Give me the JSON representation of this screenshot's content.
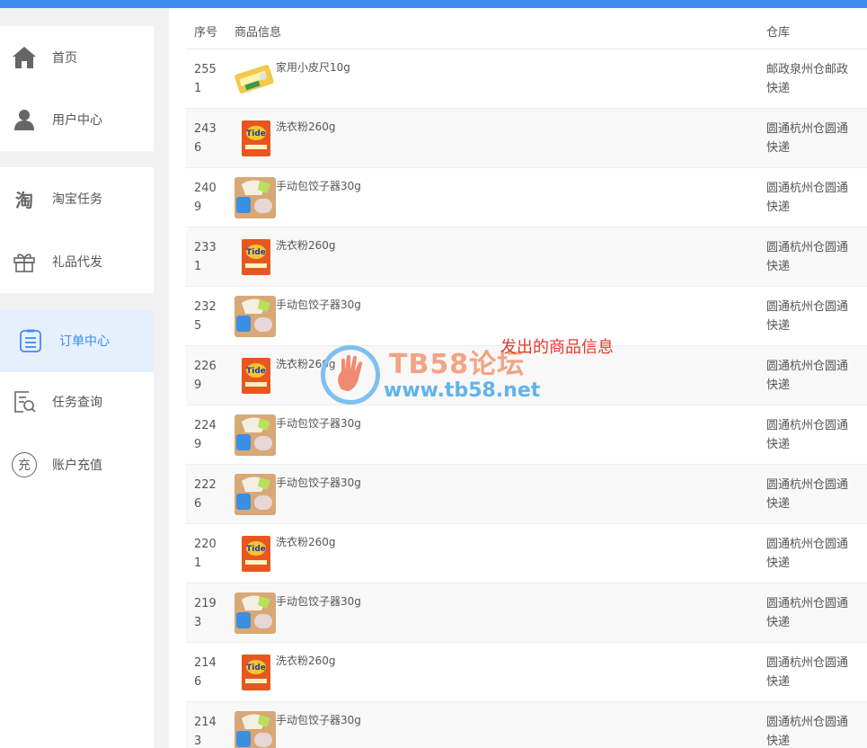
{
  "sidebar": {
    "items": [
      {
        "label": "首页",
        "icon": "home-icon"
      },
      {
        "label": "用户中心",
        "icon": "user-icon"
      },
      {
        "label": "淘宝任务",
        "icon": "taobao-icon"
      },
      {
        "label": "礼品代发",
        "icon": "gift-icon"
      },
      {
        "label": "订单中心",
        "icon": "order-list-icon",
        "active": true
      },
      {
        "label": "任务查询",
        "icon": "task-search-icon"
      },
      {
        "label": "账户充值",
        "icon": "recharge-icon"
      }
    ],
    "taobao_glyph": "淘",
    "recharge_glyph": "充"
  },
  "table": {
    "headers": {
      "id": "序号",
      "product": "商品信息",
      "warehouse": "仓库"
    },
    "rows": [
      {
        "id": "2551",
        "product": "家用小皮尺10g",
        "thumb": "tape",
        "warehouse": "邮政泉州仓邮政快递"
      },
      {
        "id": "2436",
        "product": "洗衣粉260g",
        "thumb": "detergent",
        "warehouse": "圆通杭州仓圆通快递"
      },
      {
        "id": "2409",
        "product": "手动包饺子器30g",
        "thumb": "dumpling",
        "warehouse": "圆通杭州仓圆通快递"
      },
      {
        "id": "2331",
        "product": "洗衣粉260g",
        "thumb": "detergent",
        "warehouse": "圆通杭州仓圆通快递"
      },
      {
        "id": "2325",
        "product": "手动包饺子器30g",
        "thumb": "dumpling",
        "warehouse": "圆通杭州仓圆通快递"
      },
      {
        "id": "2269",
        "product": "洗衣粉260g",
        "thumb": "detergent",
        "warehouse": "圆通杭州仓圆通快递"
      },
      {
        "id": "2249",
        "product": "手动包饺子器30g",
        "thumb": "dumpling",
        "warehouse": "圆通杭州仓圆通快递"
      },
      {
        "id": "2226",
        "product": "手动包饺子器30g",
        "thumb": "dumpling",
        "warehouse": "圆通杭州仓圆通快递"
      },
      {
        "id": "2201",
        "product": "洗衣粉260g",
        "thumb": "detergent",
        "warehouse": "圆通杭州仓圆通快递"
      },
      {
        "id": "2193",
        "product": "手动包饺子器30g",
        "thumb": "dumpling",
        "warehouse": "圆通杭州仓圆通快递"
      },
      {
        "id": "2146",
        "product": "洗衣粉260g",
        "thumb": "detergent",
        "warehouse": "圆通杭州仓圆通快递"
      },
      {
        "id": "2143",
        "product": "手动包饺子器30g",
        "thumb": "dumpling",
        "warehouse": "圆通杭州仓圆通快递"
      }
    ]
  },
  "watermark": {
    "title": "TB58论坛",
    "url": "www.tb58.net"
  },
  "annotation": "发出的商品信息",
  "colors": {
    "accent": "#3e8cf0",
    "annotation": "#e23a2a",
    "active_bg": "#e6f0fd"
  }
}
